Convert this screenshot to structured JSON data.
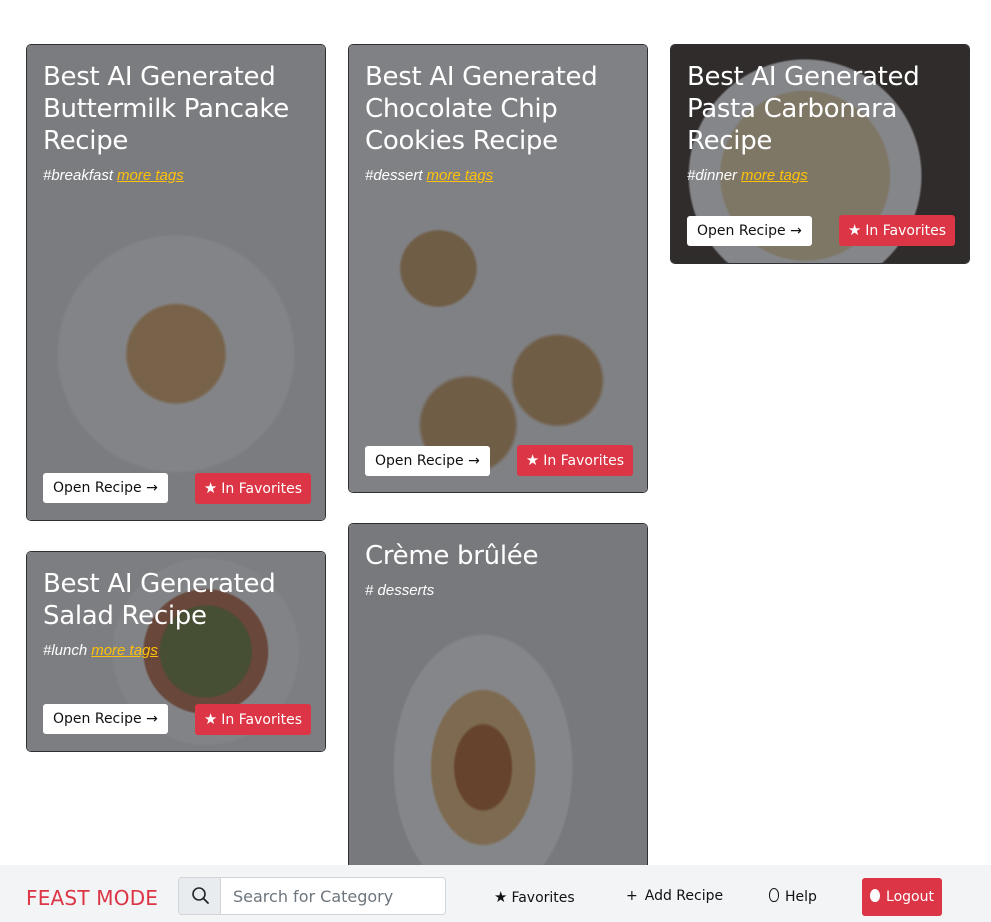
{
  "cards": [
    {
      "title": "Best AI Generated Buttermilk Pancake Recipe",
      "tag": "#breakfast",
      "more_tags": "more tags",
      "open_label": "Open Recipe →",
      "favorite_label": "In Favorites"
    },
    {
      "title": "Best AI Generated Chocolate Chip Cookies Recipe",
      "tag": "#dessert",
      "more_tags": "more tags",
      "open_label": "Open Recipe →",
      "favorite_label": "In Favorites"
    },
    {
      "title": "Best AI Generated Pasta Carbonara Recipe",
      "tag": "#dinner",
      "more_tags": "more tags",
      "open_label": "Open Recipe →",
      "favorite_label": "In Favorites"
    },
    {
      "title": "Best AI Generated Salad Recipe",
      "tag": "#lunch",
      "more_tags": "more tags",
      "open_label": "Open Recipe →",
      "favorite_label": "In Favorites"
    },
    {
      "title": "Crème brûlée",
      "tag": "# desserts"
    }
  ],
  "nav": {
    "brand": "FEAST MODE",
    "search_placeholder": "Search for Category",
    "favorites": "Favorites",
    "add_recipe": "Add Recipe",
    "help": "Help",
    "logout": "Logout",
    "search_icon": "search-icon",
    "star_icon": "star-icon",
    "plus_icon": "plus-icon",
    "help_icon": "lightbulb-icon",
    "logout_icon": "egg-icon"
  },
  "colors": {
    "brand": "#dc3545",
    "favorite_button": "#dc3545",
    "more_tags_link": "#ffc107",
    "bottom_bar": "#f3f4f6"
  }
}
